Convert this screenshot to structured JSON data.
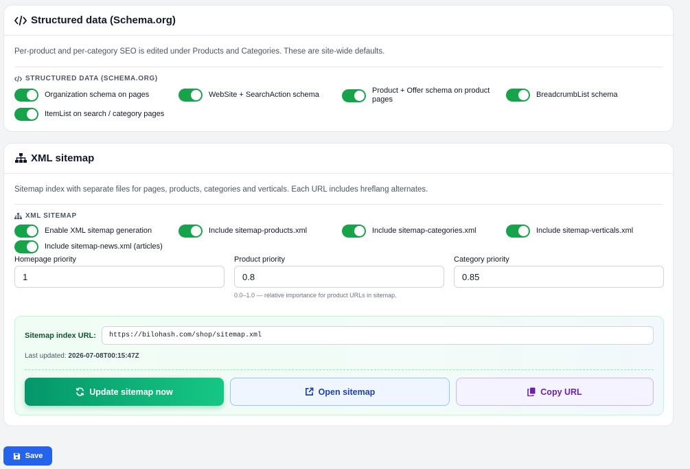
{
  "structured": {
    "title": "Structured data (Schema.org)",
    "description": "Per-product and per-category SEO is edited under Products and Categories. These are site-wide defaults.",
    "subheading": "STRUCTURED DATA (SCHEMA.ORG)",
    "toggles": [
      {
        "label": "Organization schema on pages",
        "on": true
      },
      {
        "label": "WebSite + SearchAction schema",
        "on": true
      },
      {
        "label": "Product + Offer schema on product pages",
        "on": true
      },
      {
        "label": "BreadcrumbList schema",
        "on": true
      },
      {
        "label": "ItemList on search / category pages",
        "on": true
      }
    ]
  },
  "sitemap": {
    "title": "XML sitemap",
    "description": "Sitemap index with separate files for pages, products, categories and verticals. Each URL includes hreflang alternates.",
    "subheading": "XML SITEMAP",
    "toggles": [
      {
        "label": "Enable XML sitemap generation",
        "on": true
      },
      {
        "label": "Include sitemap-products.xml",
        "on": true
      },
      {
        "label": "Include sitemap-categories.xml",
        "on": true
      },
      {
        "label": "Include sitemap-verticals.xml",
        "on": true
      },
      {
        "label": "Include sitemap-news.xml (articles)",
        "on": true
      }
    ],
    "homepage_priority": {
      "label": "Homepage priority",
      "value": "1"
    },
    "product_priority": {
      "label": "Product priority",
      "value": "0.8",
      "hint": "0.0–1.0 — relative importance for product URLs in sitemap."
    },
    "category_priority": {
      "label": "Category priority",
      "value": "0.85"
    },
    "index_url_label": "Sitemap index URL:",
    "index_url": "https://bilohash.com/shop/sitemap.xml",
    "last_updated_label": "Last updated:",
    "last_updated": "2026-07-08T00:15:47Z",
    "update_button": "Update sitemap now",
    "open_button": "Open sitemap",
    "copy_button": "Copy URL"
  },
  "save_button": "Save",
  "colors": {
    "toggle_on": "#16a34a",
    "save": "#2563eb",
    "update": "#059669",
    "open": "#1e40af",
    "copy": "#6b21a8"
  }
}
